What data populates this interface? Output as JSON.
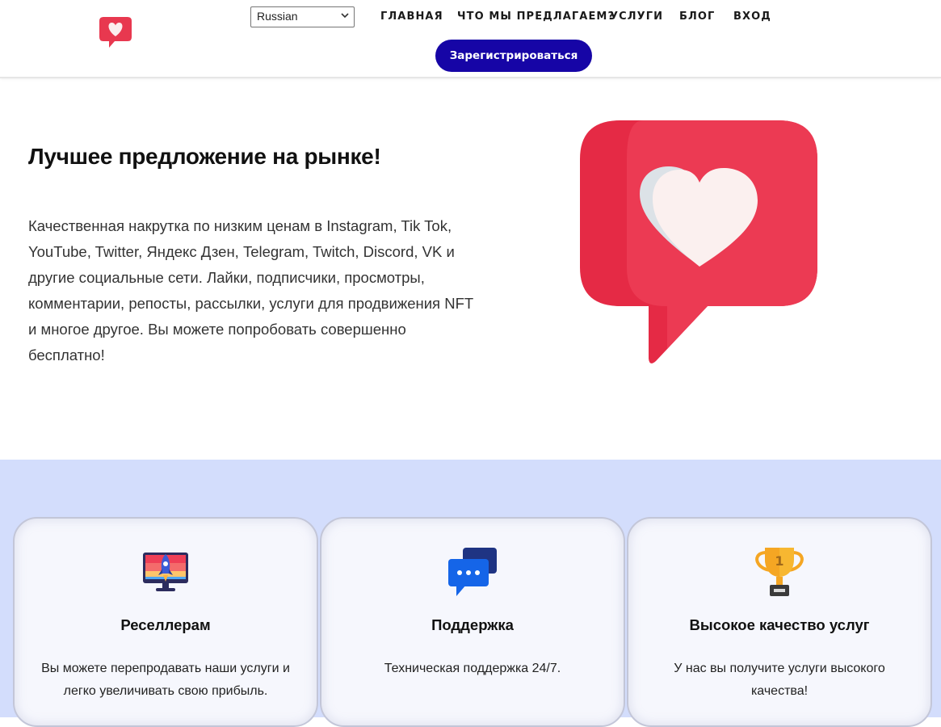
{
  "header": {
    "language": "Russian",
    "nav": [
      {
        "label": "ГЛАВНАЯ"
      },
      {
        "label": "ЧТО МЫ ПРЕДЛАГАЕМ?"
      },
      {
        "label": "УСЛУГИ"
      },
      {
        "label": "БЛОГ"
      },
      {
        "label": "ВХОД"
      }
    ],
    "register_label": "Зарегистрироваться"
  },
  "hero": {
    "title": "Лучшее предложение на рынке!",
    "text": "Качественная накрутка по низким ценам в Instagram, Tik Tok, YouTube, Twitter, Яндекс Дзен, Telegram, Twitch, Discord, VK и другие социальные сети. Лайки, подписчики, просмотры, комментарии, репосты, рассылки, услуги для продвижения NFT и многое другое. Вы можете попробовать совершенно бесплатно!"
  },
  "features": [
    {
      "icon": "rocket-monitor-icon",
      "title": "Реселлерам",
      "text": "Вы можете перепродавать наши услуги и легко увеличивать свою прибыль."
    },
    {
      "icon": "chat-bubbles-icon",
      "title": "Поддержка",
      "text": "Техническая поддержка 24/7."
    },
    {
      "icon": "trophy-icon",
      "title": "Высокое качество услуг",
      "text": "У нас вы получите услуги высокого качества!",
      "trophy_rank": "1"
    }
  ],
  "colors": {
    "accent": "#1605a6",
    "logo_red": "#e8384f",
    "features_bg": "#d3ddfc"
  }
}
